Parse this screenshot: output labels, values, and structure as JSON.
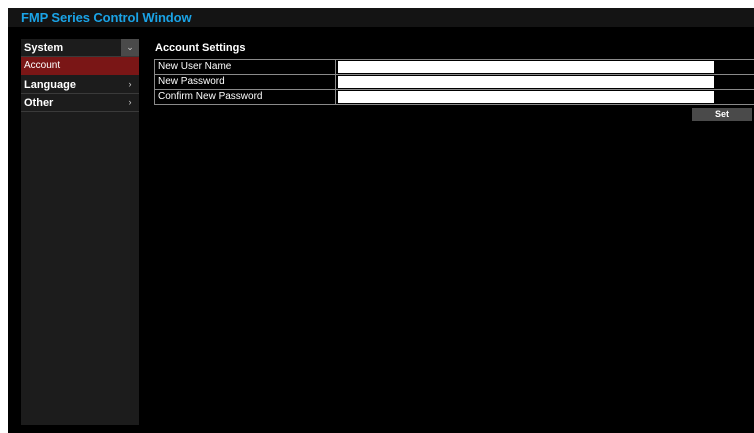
{
  "window": {
    "title": "FMP Series Control Window",
    "title_color": "#1aa3e6"
  },
  "sidebar": {
    "items": [
      {
        "label": "System",
        "chevron": "⌄",
        "expanded": true,
        "children": [
          {
            "label": "Account",
            "selected": true
          }
        ]
      },
      {
        "label": "Language",
        "chevron": "›",
        "expanded": false
      },
      {
        "label": "Other",
        "chevron": "›",
        "expanded": false
      }
    ],
    "selected_color": "#7a1616"
  },
  "main": {
    "section_title": "Account Settings",
    "fields": [
      {
        "label": "New User Name",
        "value": ""
      },
      {
        "label": "New Password",
        "value": ""
      },
      {
        "label": "Confirm New Password",
        "value": ""
      }
    ],
    "set_label": "Set"
  }
}
